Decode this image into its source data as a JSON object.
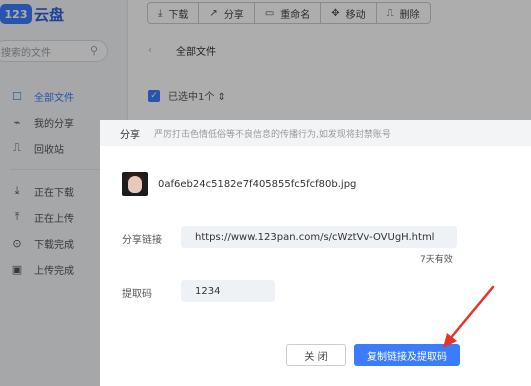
{
  "app": {
    "logo_mark": "123",
    "logo_text": "云盘"
  },
  "sidebar": {
    "search_placeholder": "搜索的文件",
    "items": [
      {
        "label": "全部文件",
        "icon": "folder-icon",
        "glyph": "☐",
        "active": true
      },
      {
        "label": "我的分享",
        "icon": "share-icon",
        "glyph": "⌁"
      },
      {
        "label": "回收站",
        "icon": "trash-icon",
        "glyph": "⎍"
      },
      {
        "label": "正在下载",
        "icon": "download-icon",
        "glyph": "⤓"
      },
      {
        "label": "正在上传",
        "icon": "upload-icon",
        "glyph": "⤒"
      },
      {
        "label": "下载完成",
        "icon": "check-circle-icon",
        "glyph": "⊙"
      },
      {
        "label": "上传完成",
        "icon": "file-check-icon",
        "glyph": "▣"
      }
    ]
  },
  "toolbar": {
    "buttons": [
      {
        "label": "下载",
        "icon": "download-icon",
        "glyph": "⤓"
      },
      {
        "label": "分享",
        "icon": "share-icon",
        "glyph": "↗"
      },
      {
        "label": "重命名",
        "icon": "rename-icon",
        "glyph": "▭"
      },
      {
        "label": "移动",
        "icon": "move-icon",
        "glyph": "✥"
      },
      {
        "label": "删除",
        "icon": "delete-icon",
        "glyph": "⎍"
      }
    ]
  },
  "breadcrumb": {
    "back": "‹",
    "current": "全部文件"
  },
  "selection": {
    "label": "已选中1个 ⇕"
  },
  "dialog": {
    "title": "分享",
    "notice": "严厉打击色情低俗等不良信息的传播行为,如发现将封禁账号",
    "file_name": "0af6eb24c5182e7f405855fc5fcf80b.jpg",
    "link_label": "分享链接",
    "link_value": "https://www.123pan.com/s/cWztVv-OVUgH.html",
    "expiry": "7天有效",
    "code_label": "提取码",
    "code_value": "1234",
    "close_label": "关 闭",
    "copy_label": "复制链接及提取码"
  },
  "colors": {
    "accent": "#3b7cff",
    "annotation_arrow": "#e8322b"
  }
}
